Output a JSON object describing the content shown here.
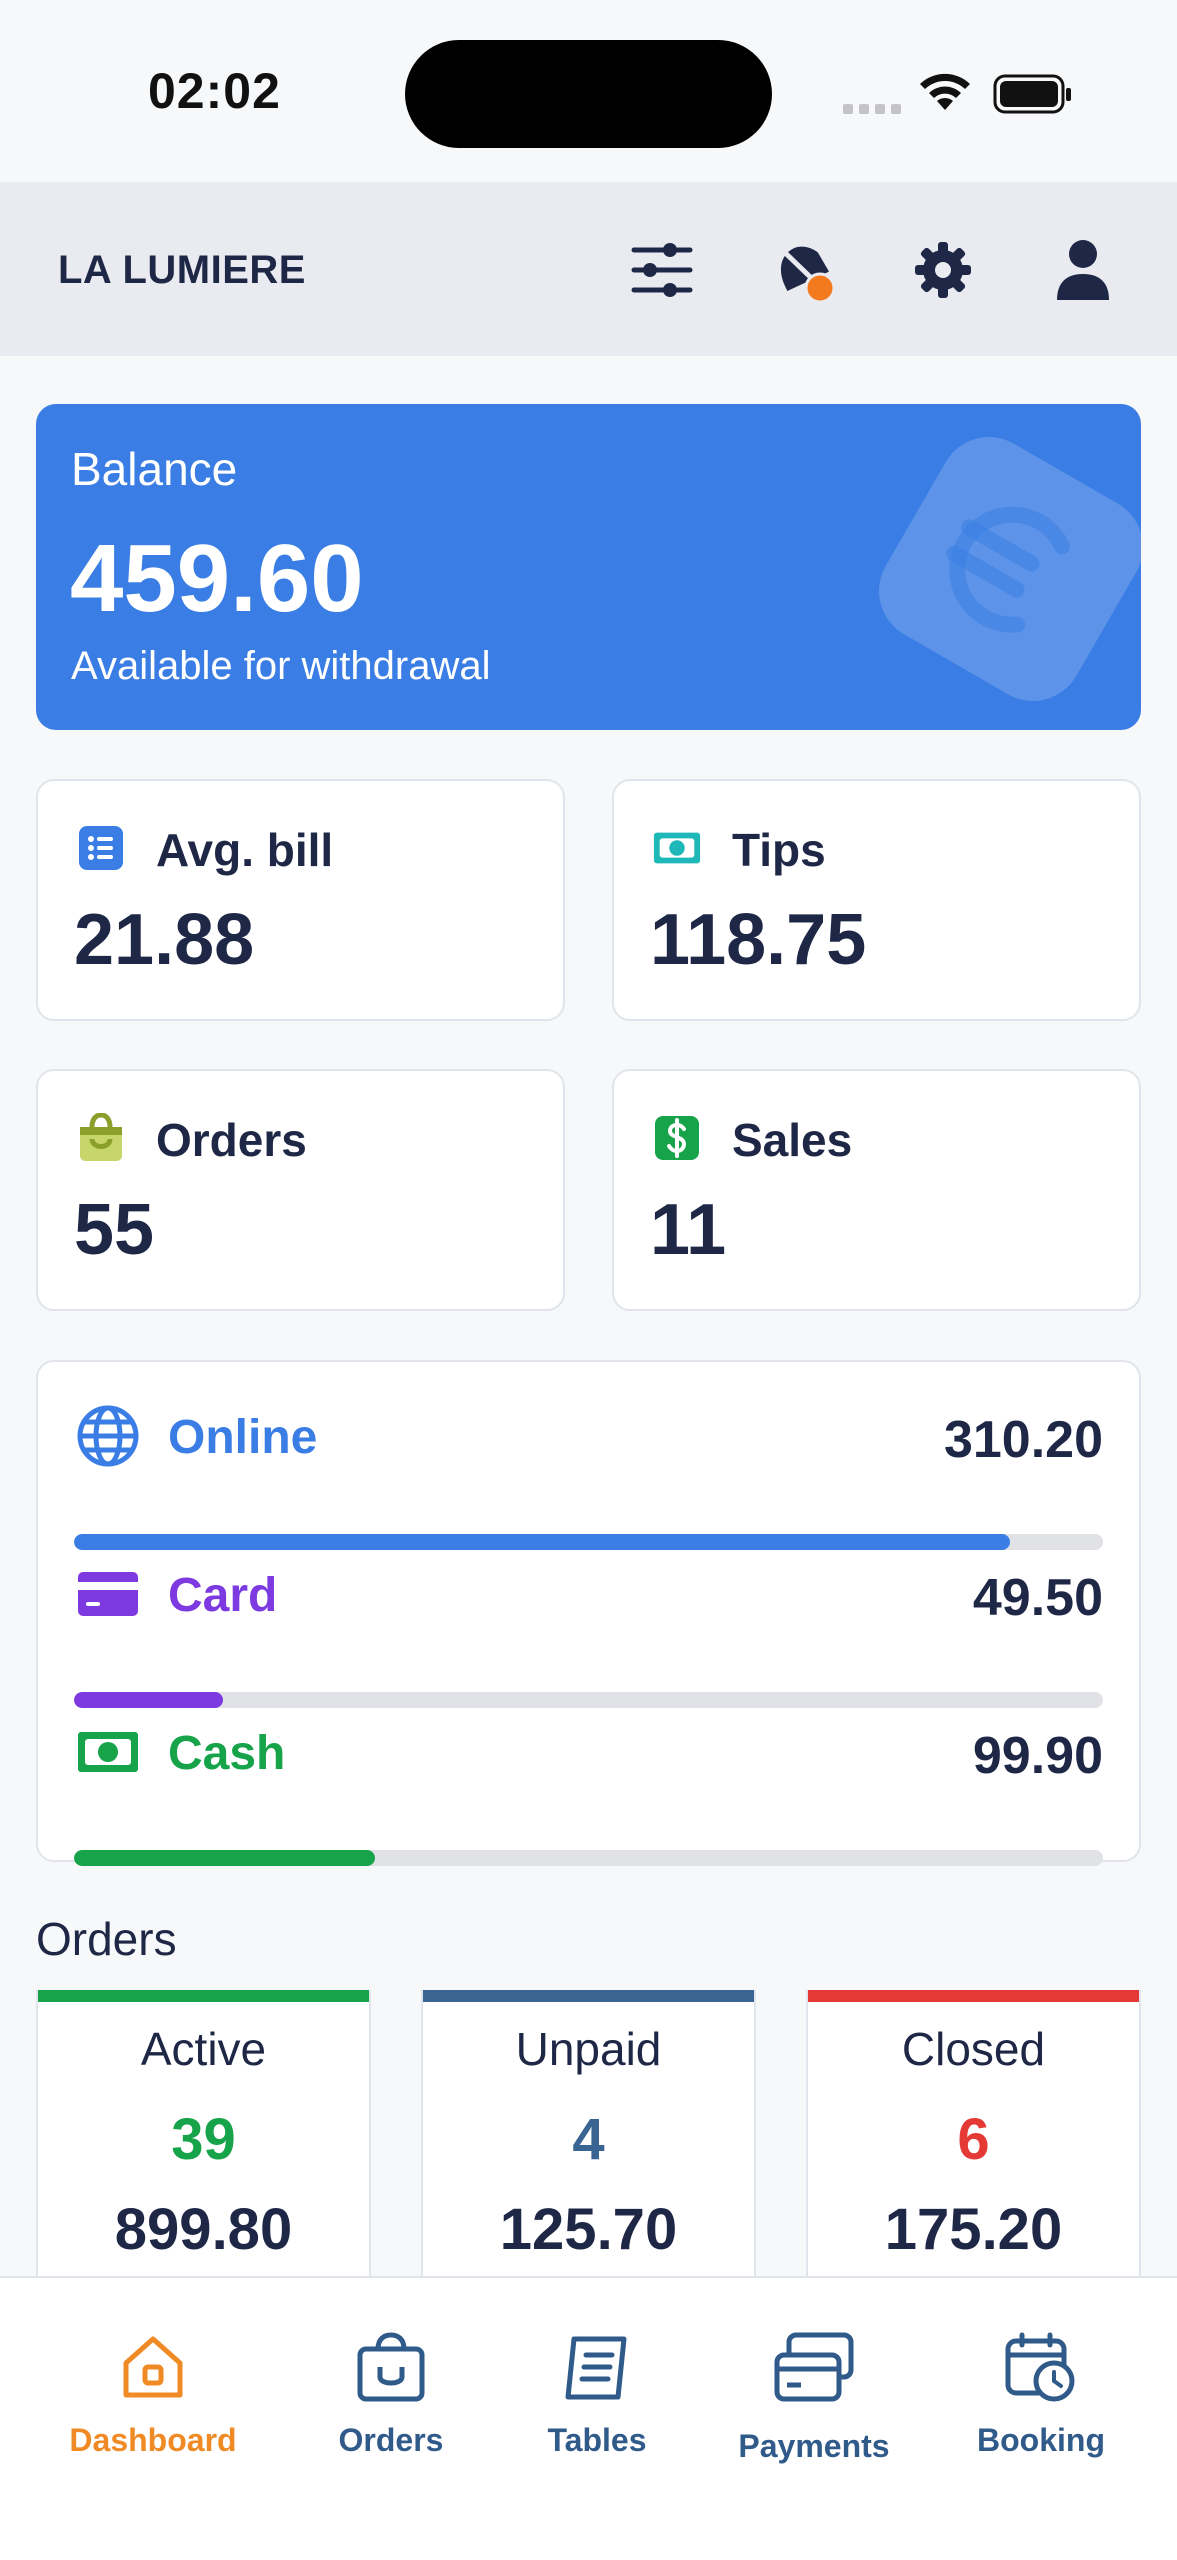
{
  "status_bar": {
    "time": "02:02"
  },
  "header": {
    "title": "LA LUMIERE",
    "icons": [
      "sliders-icon",
      "bell-off-icon",
      "gear-icon",
      "user-icon"
    ],
    "notification_dot_color": "#f47a1f"
  },
  "balance": {
    "label": "Balance",
    "value": "459.60",
    "subtitle": "Available for withdrawal",
    "icon": "euro-icon",
    "color": "#3a7de4"
  },
  "stats": {
    "avg_bill": {
      "label": "Avg. bill",
      "value": "21.88",
      "icon": "list-icon",
      "color": "#3a7de4"
    },
    "tips": {
      "label": "Tips",
      "value": "118.75",
      "icon": "banknote-icon",
      "color": "#1fb8b8"
    },
    "orders": {
      "label": "Orders",
      "value": "55",
      "icon": "shopping-bag-icon",
      "color": "#8aa02a"
    },
    "sales": {
      "label": "Sales",
      "value": "11",
      "icon": "dollar-icon",
      "color": "#16a34a"
    }
  },
  "payments": {
    "online": {
      "label": "Online",
      "amount": "310.20",
      "share_percent": 91,
      "icon": "globe-icon",
      "color": "#3a7de4"
    },
    "card": {
      "label": "Card",
      "amount": "49.50",
      "share_percent": 14.5,
      "icon": "credit-card-icon",
      "color": "#7c3ae0"
    },
    "cash": {
      "label": "Cash",
      "amount": "99.90",
      "share_percent": 29.3,
      "icon": "cash-icon",
      "color": "#16a34a"
    }
  },
  "orders_section": {
    "title": "Orders",
    "active": {
      "label": "Active",
      "count": "39",
      "amount": "899.80",
      "color": "#16a34a"
    },
    "unpaid": {
      "label": "Unpaid",
      "count": "4",
      "amount": "125.70",
      "color": "#3a6593"
    },
    "closed": {
      "label": "Closed",
      "count": "6",
      "amount": "175.20",
      "color": "#e53935"
    }
  },
  "bottom_nav": {
    "dashboard": {
      "label": "Dashboard",
      "icon": "home-icon",
      "active": true
    },
    "orders": {
      "label": "Orders",
      "icon": "shopping-bag-icon"
    },
    "tables": {
      "label": "Tables",
      "icon": "menu-book-icon"
    },
    "payments": {
      "label": "Payments",
      "icon": "credit-cards-icon"
    },
    "booking": {
      "label": "Booking",
      "icon": "calendar-clock-icon"
    }
  }
}
